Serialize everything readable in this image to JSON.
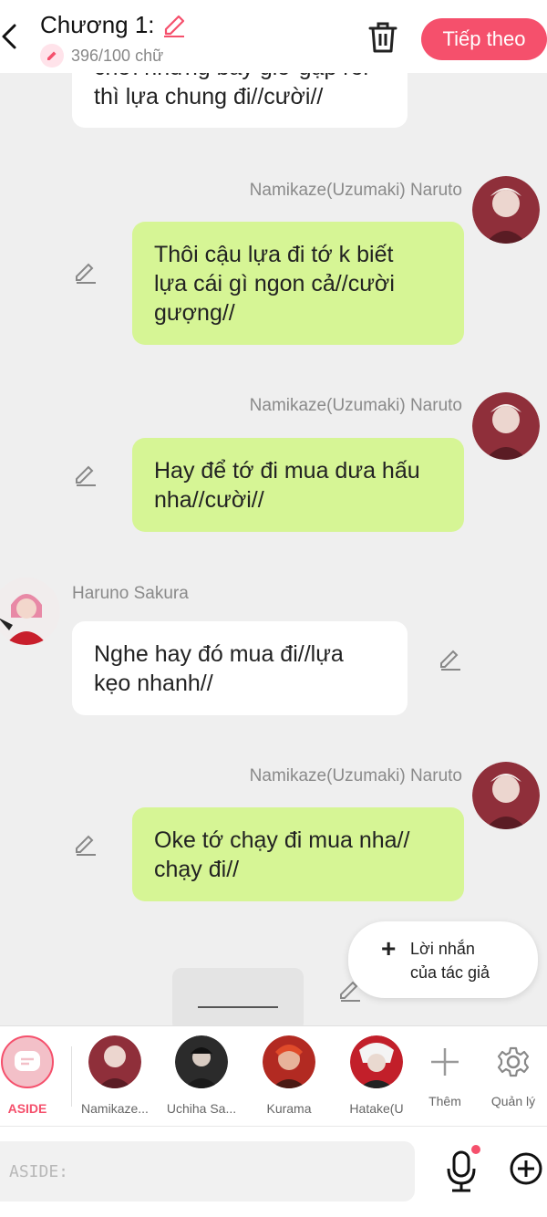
{
  "header": {
    "title": "Chương 1:",
    "word_count": "396/100 chữ",
    "next_label": "Tiếp theo"
  },
  "messages": [
    {
      "speaker": "",
      "side": "left",
      "lines": [
        "chơi nhưng bây giờ gặp rồi",
        "thì lựa chung đi//cười//"
      ]
    },
    {
      "speaker": "Namikaze(Uzumaki) Naruto",
      "side": "right",
      "lines": [
        "Thôi cậu lựa đi tớ k biết",
        "lựa cái gì ngon cả//cười",
        "gượng//"
      ]
    },
    {
      "speaker": "Namikaze(Uzumaki) Naruto",
      "side": "right",
      "lines": [
        "Hay để tớ đi mua dưa hấu",
        "nha//cười//"
      ]
    },
    {
      "speaker": "Haruno Sakura",
      "side": "left",
      "lines": [
        "Nghe hay đó mua đi//lựa",
        "kẹo nhanh//"
      ]
    },
    {
      "speaker": "Namikaze(Uzumaki) Naruto",
      "side": "right",
      "lines": [
        "Oke tớ chạy đi mua nha//",
        "chạy đi//"
      ]
    }
  ],
  "author_note": {
    "line1": "Lời nhắn",
    "line2": "của tác giả"
  },
  "aside_card_text": "________",
  "characters": [
    {
      "label": "ASIDE"
    },
    {
      "label": "Namikaze..."
    },
    {
      "label": "Uchiha Sa..."
    },
    {
      "label": "Kurama"
    },
    {
      "label": "Hatake(U"
    },
    {
      "label": "Thêm"
    },
    {
      "label": "Quản lý"
    }
  ],
  "input": {
    "placeholder": "ASIDE:"
  },
  "colors": {
    "accent": "#f5506c",
    "right_bubble": "#d6f595",
    "left_bubble": "#ffffff",
    "background": "#efefef"
  }
}
